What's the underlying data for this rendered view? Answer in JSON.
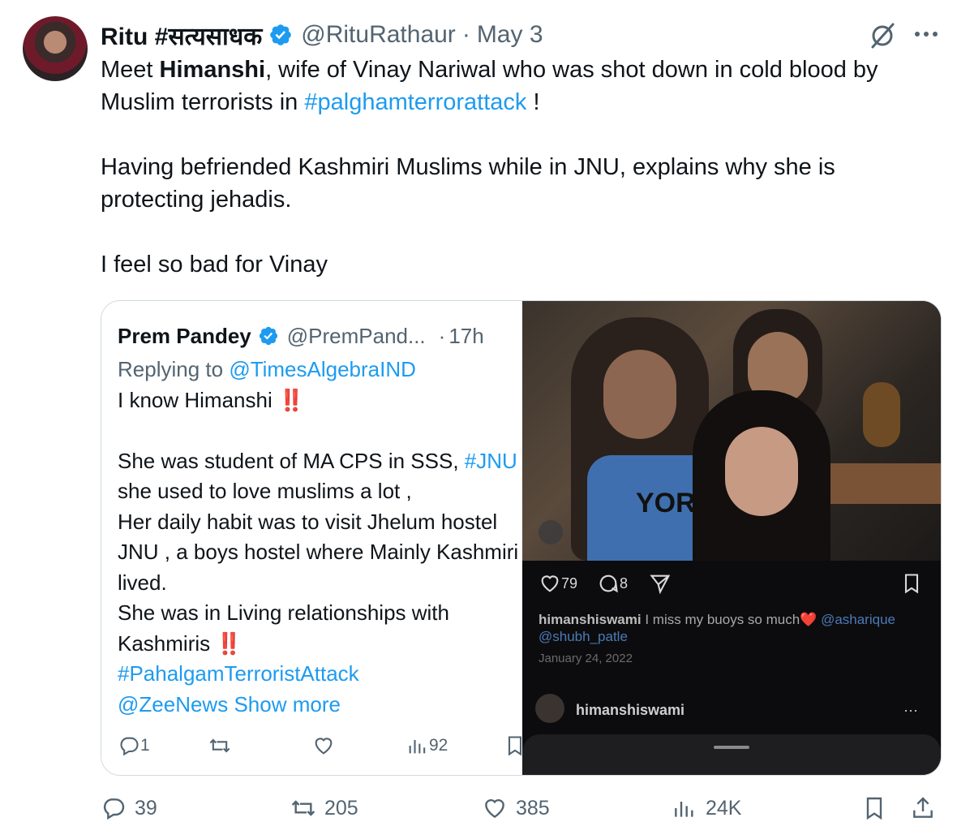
{
  "tweet": {
    "author_name": "Ritu #सत्यसाधक",
    "handle": "@RituRathaur",
    "dot": "·",
    "date": "May 3",
    "text": {
      "p1_a": "Meet ",
      "p1_bold": "Himanshi",
      "p1_b": ", wife of Vinay Nariwal who was shot down in cold blood by Muslim terrorists in ",
      "p1_hashtag": "#palghamterrorattack",
      "p1_c": " !",
      "p2": "Having befriended Kashmiri Muslims while in JNU, explains why she is protecting jehadis.",
      "p3": "I feel so bad for Vinay"
    }
  },
  "quoted": {
    "name": "Prem Pandey",
    "handle": "@PremPand...",
    "dot": "·",
    "time": "17h",
    "replying_prefix": "Replying to ",
    "replying_to": "@TimesAlgebraIND",
    "line1": "I know Himanshi ",
    "bang": "‼️",
    "line2_a": "She was student of MA CPS in SSS, ",
    "line2_tag": "#JNU",
    "line3": "she used to love muslims a lot ,",
    "line4": "Her daily habit was to visit Jhelum hostel",
    "line5": "JNU , a boys hostel where Mainly Kashmiri",
    "line6": "lived.",
    "line7": "She was in Living relationships with",
    "line8": "Kashmiris ",
    "hashtag": "#PahalgamTerroristAttack",
    "mention": "@ZeeNews",
    "show_more": " Show more",
    "reply_count": "1",
    "views": "92"
  },
  "photo": {
    "shirt_text": "YORK",
    "likes": "79",
    "comments": "8",
    "caption_user": "himanshiswami",
    "caption_text": " I miss my buoys so much❤️ ",
    "caption_tag1": "@asharique",
    "caption_tag2": "@shubh_patle",
    "date": "January 24, 2022",
    "footer_user": "himanshiswami",
    "more": "···"
  },
  "actions": {
    "replies": "39",
    "reposts": "205",
    "likes": "385",
    "views": "24K"
  },
  "icons": {
    "verified": "verified-badge-icon",
    "grok": "grok-icon",
    "more": "more-icon"
  },
  "colors": {
    "accent": "#1d9bf0",
    "muted": "#536471",
    "text": "#0f1419",
    "border": "#cfd9de"
  }
}
